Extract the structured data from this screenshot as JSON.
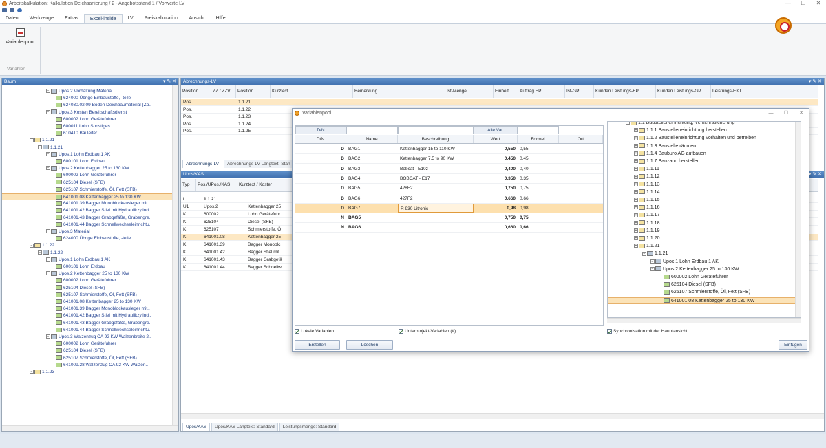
{
  "window": {
    "title": "Arbeitskalkulation: Kalkulation Deichsanierung / 2 - Angebotsstand 1 / Vorwerte LV",
    "controls": [
      "—",
      "☐",
      "✕"
    ]
  },
  "ribbon": {
    "tabs": [
      "Daten",
      "Werkzeuge",
      "Extras",
      "Excel-inside",
      "LV",
      "Preiskalkulation",
      "Ansicht",
      "Hilfe"
    ],
    "active_tab": "Excel-inside",
    "button_label": "Variablenpool",
    "group_label": "Variablen"
  },
  "left_panel": {
    "title": "Baum",
    "tree": [
      {
        "label": "Upos.2 Vorhaltung Material",
        "kind": "m"
      },
      {
        "label": "624000 Übrige Einbaustoffe, -teile",
        "kind": "k"
      },
      {
        "label": "624030.02.09 Boden Deichbaumaterial (Zo..",
        "kind": "k"
      },
      {
        "label": "Upos.3 Kosten Bereitschaftsdienst",
        "kind": "m"
      },
      {
        "label": "600002 Lohn Gerätefuhrer",
        "kind": "k"
      },
      {
        "label": "600011 Lohn Sonstiges",
        "kind": "k"
      },
      {
        "label": "610410 Bauleiter",
        "kind": "k"
      },
      {
        "label": "1.1.21",
        "kind": "f"
      },
      {
        "label": "1.1.21",
        "kind": "m"
      },
      {
        "label": "Upos.1 Lohn Erdbau 1 AK",
        "kind": "m"
      },
      {
        "label": "600101 Lohn Erdbau",
        "kind": "k"
      },
      {
        "label": "Upos.2 Kettenbagger 25 to 130 KW",
        "kind": "m"
      },
      {
        "label": "600002 Lohn Gerätefuhrer",
        "kind": "k"
      },
      {
        "label": "625104 Diesel (SFB)",
        "kind": "k"
      },
      {
        "label": "625107 Schmierstoffe, Öl, Fett (SFB)",
        "kind": "k"
      },
      {
        "label": "641001.08 Kettenbagger 25 to 130 KW",
        "kind": "k",
        "selected": true
      },
      {
        "label": "641001.39 Bagger Monoblockausleger mit..",
        "kind": "k"
      },
      {
        "label": "641001.42 Bagger Stiel mit Hydraulikzylind..",
        "kind": "k"
      },
      {
        "label": "641001.43 Bagger Grabgefäße, Grabengre..",
        "kind": "k"
      },
      {
        "label": "641001.44 Bagger Schnellwechseleinrichtu..",
        "kind": "k"
      },
      {
        "label": "Upos.3 Material",
        "kind": "m"
      },
      {
        "label": "624000 Übrige Einbaustoffe, -teile",
        "kind": "k"
      },
      {
        "label": "1.1.22",
        "kind": "f"
      },
      {
        "label": "1.1.22",
        "kind": "m"
      },
      {
        "label": "Upos.1 Lohn Erdbau 1 AK",
        "kind": "m"
      },
      {
        "label": "600101 Lohn Erdbau",
        "kind": "k"
      },
      {
        "label": "Upos.2 Kettenbagger 25 to 130 KW",
        "kind": "m"
      },
      {
        "label": "600002 Lohn Gerätefuhrer",
        "kind": "k"
      },
      {
        "label": "625104 Diesel (SFB)",
        "kind": "k"
      },
      {
        "label": "625107 Schmierstoffe, Öl, Fett (SFB)",
        "kind": "k"
      },
      {
        "label": "641001.08 Kettenbagger 25 to 130 KW",
        "kind": "k"
      },
      {
        "label": "641001.39 Bagger Monoblockausleger mit..",
        "kind": "k"
      },
      {
        "label": "641001.42 Bagger Stiel mit Hydraulikzylind..",
        "kind": "k"
      },
      {
        "label": "641001.43 Bagger Grabgefäße, Grabengre..",
        "kind": "k"
      },
      {
        "label": "641001.44 Bagger Schnellwechseleinrichtu..",
        "kind": "k"
      },
      {
        "label": "Upos.3 Walzenzug CA 92 KW Walzenbreite 2..",
        "kind": "m"
      },
      {
        "label": "600002 Lohn Gerätefuhrer",
        "kind": "k"
      },
      {
        "label": "625104 Diesel (SFB)",
        "kind": "k"
      },
      {
        "label": "625107 Schmierstoffe, Öl, Fett (SFB)",
        "kind": "k"
      },
      {
        "label": "641009.28 Walzenzug CA 92 KW Walzen..",
        "kind": "k"
      },
      {
        "label": "1.1.23",
        "kind": "f"
      }
    ]
  },
  "lv_panel": {
    "title": "Abrechnungs-LV",
    "columns": [
      "Position...",
      "ZZ / ZZV",
      "Position",
      "Kurztext",
      "Bemerkung",
      "Ist-Menge",
      "Einheit",
      "Auftrag EP",
      "Ist-GP",
      "Kunden Leistungs-EP",
      "Kunden Leistungs-GP",
      "Leistungs-EKT"
    ],
    "rows": [
      {
        "typ": "Pos.",
        "pos": "1.1.21",
        "hl": true
      },
      {
        "typ": "Pos.",
        "pos": "1.1.22"
      },
      {
        "typ": "Pos.",
        "pos": "1.1.23"
      },
      {
        "typ": "Pos.",
        "pos": "1.1.24"
      },
      {
        "typ": "Pos.",
        "pos": "1.1.25"
      }
    ],
    "tabs": [
      "Abrechnungs-LV",
      "Abrechnungs-LV Langtext: Stan"
    ]
  },
  "upos_panel": {
    "title": "Upos/KAS",
    "columns": [
      "Typ",
      "Pos./UPos./KAS",
      "Kurztext / Koster"
    ],
    "rows": [
      {
        "typ": "L",
        "pos": "1.1.21",
        "text": "",
        "bold": true
      },
      {
        "typ": "U1",
        "pos": "Upos.2",
        "text": "Kettenbagger 25"
      },
      {
        "typ": "K",
        "pos": "600002",
        "text": "Lohn Gerätefuhr"
      },
      {
        "typ": "K",
        "pos": "625104",
        "text": "Diesel (SFB)"
      },
      {
        "typ": "K",
        "pos": "625107",
        "text": "Schmierstoffe, Ö"
      },
      {
        "typ": "K",
        "pos": "641001.08",
        "text": "Kettenbagger 25",
        "hl": true
      },
      {
        "typ": "K",
        "pos": "641001.39",
        "text": "Bagger Monoblc"
      },
      {
        "typ": "K",
        "pos": "641001.42",
        "text": "Bagger Stiel mit"
      },
      {
        "typ": "K",
        "pos": "641001.43",
        "text": "Bagger Grabgefä"
      },
      {
        "typ": "K",
        "pos": "641001.44",
        "text": "Bagger Schnellw"
      }
    ],
    "tabs": [
      "Upos/KAS",
      "Upos/KAS Langtext: Standard",
      "Leistungsmenge: Standard"
    ]
  },
  "dialog": {
    "title": "Variablenpool",
    "btn_dn": "D/N",
    "btn_alle": "Alle Var.",
    "columns": [
      "D/N",
      "Name",
      "Beschreibung",
      "Wert",
      "Formel",
      "Ort"
    ],
    "rows": [
      {
        "dn": "D",
        "name": "BAG1",
        "desc": "Kettenbagger 15 to 110 KW",
        "wert": "0,550",
        "formel": "0,55"
      },
      {
        "dn": "D",
        "name": "BAG2",
        "desc": "Kettenbagger 7,5 to 90 KW",
        "wert": "0,450",
        "formel": "0,45"
      },
      {
        "dn": "D",
        "name": "BAG3",
        "desc": "Bobcat - E10z",
        "wert": "0,400",
        "formel": "0,40"
      },
      {
        "dn": "D",
        "name": "BAG4",
        "desc": "BOBCAT - E17",
        "wert": "0,350",
        "formel": "0,35"
      },
      {
        "dn": "D",
        "name": "BAG5",
        "desc": "428F2",
        "wert": "0,750",
        "formel": "0,75"
      },
      {
        "dn": "D",
        "name": "BAG6",
        "desc": "427F2",
        "wert": "0,660",
        "formel": "0,66"
      },
      {
        "dn": "D",
        "name": "BAG7",
        "desc": "R 930 Litronic",
        "wert": "0,98",
        "formel": "0,98",
        "hl": true
      },
      {
        "dn": "N",
        "name": "BAG5",
        "desc": "",
        "wert": "0,750",
        "formel": "0,75",
        "bold": true
      },
      {
        "dn": "N",
        "name": "BAG6",
        "desc": "",
        "wert": "0,660",
        "formel": "0,66",
        "bold": true
      }
    ],
    "tree": [
      {
        "label": "1.1 Baustelleneinrichtung, Verkehrssicherung",
        "d": 0
      },
      {
        "label": "1.1.1 Baustelleneinrichtung herstellen",
        "d": 1
      },
      {
        "label": "1.1.2 Baustelleneinrichtung vorhalten und betreiben",
        "d": 1
      },
      {
        "label": "1.1.3 Baustelle räumen",
        "d": 1
      },
      {
        "label": "1.1.4 Bauburo AG aufbauen",
        "d": 1
      },
      {
        "label": "1.1.7 Bauzaun herstellen",
        "d": 1
      },
      {
        "label": "1.1.11",
        "d": 1
      },
      {
        "label": "1.1.12",
        "d": 1
      },
      {
        "label": "1.1.13",
        "d": 1
      },
      {
        "label": "1.1.14",
        "d": 1
      },
      {
        "label": "1.1.15",
        "d": 1
      },
      {
        "label": "1.1.16",
        "d": 1
      },
      {
        "label": "1.1.17",
        "d": 1
      },
      {
        "label": "1.1.18",
        "d": 1
      },
      {
        "label": "1.1.19",
        "d": 1
      },
      {
        "label": "1.1.20",
        "d": 1
      },
      {
        "label": "1.1.21",
        "d": 1
      },
      {
        "label": "1.1.21",
        "d": 2
      },
      {
        "label": "Upos.1 Lohn Erdbau 1 AK",
        "d": 3
      },
      {
        "label": "Upos.2 Kettenbagger 25 to 130 KW",
        "d": 3
      },
      {
        "label": "600002 Lohn Gerätefuhrer",
        "d": 4
      },
      {
        "label": "625104 Diesel (SFB)",
        "d": 4
      },
      {
        "label": "625107 Schmierstoffe, Öl, Fett (SFB)",
        "d": 4
      },
      {
        "label": "641001.08 Kettenbagger 25 to 130 KW",
        "d": 4,
        "sel": true
      }
    ],
    "chk_lokal": "Lokale Variablen",
    "chk_unter": "Unterprojekt-Variablen (#)",
    "chk_sync": "Synchronisation mit der Hauptansicht",
    "btn_erstellen": "Erstellen",
    "btn_loeschen": "Löschen",
    "btn_einfuegen": "Einfügen"
  }
}
